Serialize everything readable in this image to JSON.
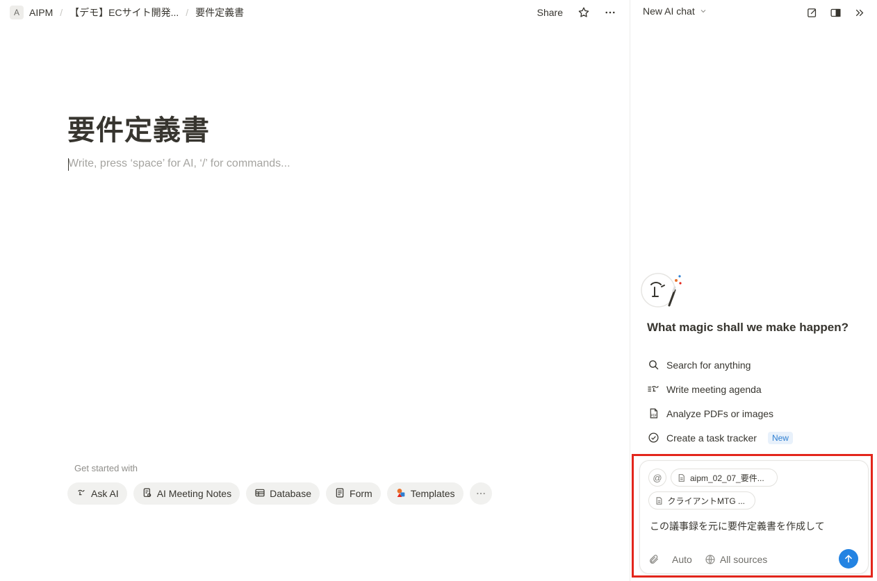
{
  "breadcrumb": {
    "workspace_initial": "A",
    "workspace": "AIPM",
    "items": [
      "【デモ】ECサイト開発...",
      "要件定義書"
    ]
  },
  "topbar": {
    "share_label": "Share"
  },
  "page": {
    "title": "要件定義書",
    "placeholder": "Write, press ‘space’ for AI, ‘/’ for commands..."
  },
  "get_started": {
    "label": "Get started with",
    "chips": [
      "Ask AI",
      "AI Meeting Notes",
      "Database",
      "Form",
      "Templates"
    ]
  },
  "ai_panel": {
    "title": "New AI chat",
    "heading": "What magic shall we make happen?",
    "suggestions": [
      {
        "label": "Search for anything",
        "icon": "search-icon"
      },
      {
        "label": "Write meeting agenda",
        "icon": "agenda-icon"
      },
      {
        "label": "Analyze PDFs or images",
        "icon": "pdf-icon"
      },
      {
        "label": "Create a task tracker",
        "icon": "check-circle-icon",
        "badge": "New"
      }
    ],
    "composer": {
      "mention_symbol": "@",
      "attachments": [
        "aipm_02_07_要件...",
        "クライアントMTG ..."
      ],
      "prompt": "この議事録を元に要件定義書を作成して",
      "mode": "Auto",
      "sources": "All sources"
    }
  },
  "colors": {
    "accent": "#2383e2",
    "highlight": "#e3261c",
    "new_badge": "#2f7fd1"
  }
}
